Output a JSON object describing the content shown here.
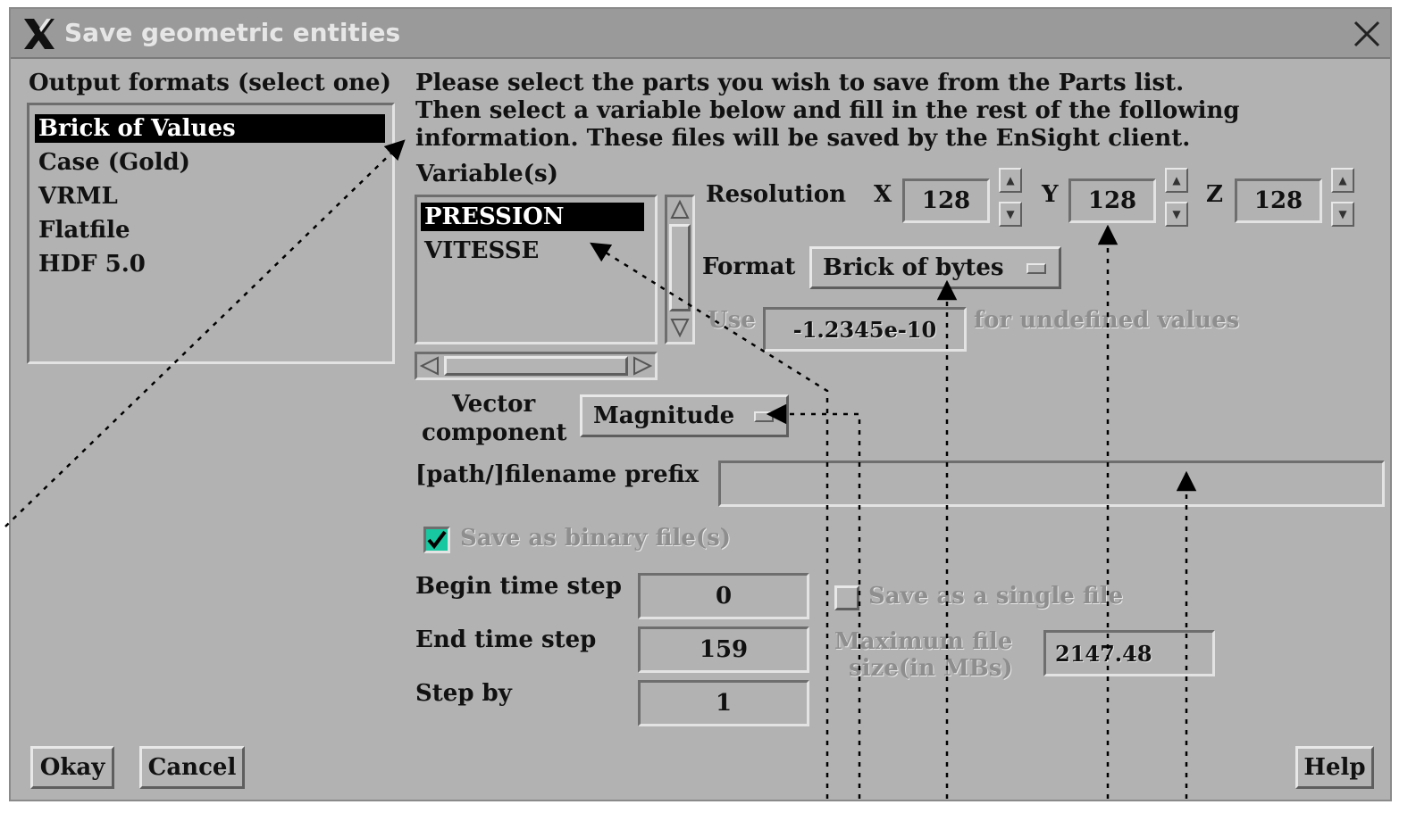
{
  "window": {
    "title": "Save geometric entities",
    "logo_icon": "x-logo-icon",
    "close_icon": "close-icon"
  },
  "formats": {
    "label": "Output formats (select one)",
    "items": [
      "Brick of Values",
      "Case (Gold)",
      "VRML",
      "Flatfile",
      "HDF 5.0"
    ],
    "selected": "Brick of Values"
  },
  "instructions": {
    "line1": "Please select the parts you wish to save from the Parts list.",
    "line2": "Then select a variable below and fill in the rest of the following",
    "line3": "information.  These files will be saved by the EnSight client."
  },
  "variables": {
    "label": "Variable(s)",
    "items": [
      "PRESSION",
      "VITESSE"
    ],
    "selected": "PRESSION"
  },
  "resolution": {
    "label": "Resolution",
    "x_label": "X",
    "x_value": "128",
    "y_label": "Y",
    "y_value": "128",
    "z_label": "Z",
    "z_value": "128"
  },
  "format": {
    "label": "Format",
    "value": "Brick of bytes"
  },
  "undefined": {
    "use_label": "Use",
    "value": "-1.2345e-10",
    "suffix": "for undefined values"
  },
  "vector": {
    "label_line1": "Vector",
    "label_line2": "component",
    "value": "Magnitude"
  },
  "filename": {
    "label": "[path/]filename prefix",
    "value": ""
  },
  "binary": {
    "label": "Save as binary file(s)",
    "checked": true
  },
  "time": {
    "begin_label": "Begin time step",
    "begin_value": "0",
    "end_label": "End time step",
    "end_value": "159",
    "step_label": "Step by",
    "step_value": "1"
  },
  "single_file": {
    "label": "Save as a single file",
    "checked": false
  },
  "max_size": {
    "label_line1": "Maximum file",
    "label_line2": "size(in MBs)",
    "value": "2147.48"
  },
  "buttons": {
    "okay": "Okay",
    "cancel": "Cancel",
    "help": "Help"
  },
  "colors": {
    "background": "#b2b2b2",
    "titlebar": "#9a9a9a",
    "selection": "#000000",
    "checkbox_fill": "#18c8a0"
  }
}
